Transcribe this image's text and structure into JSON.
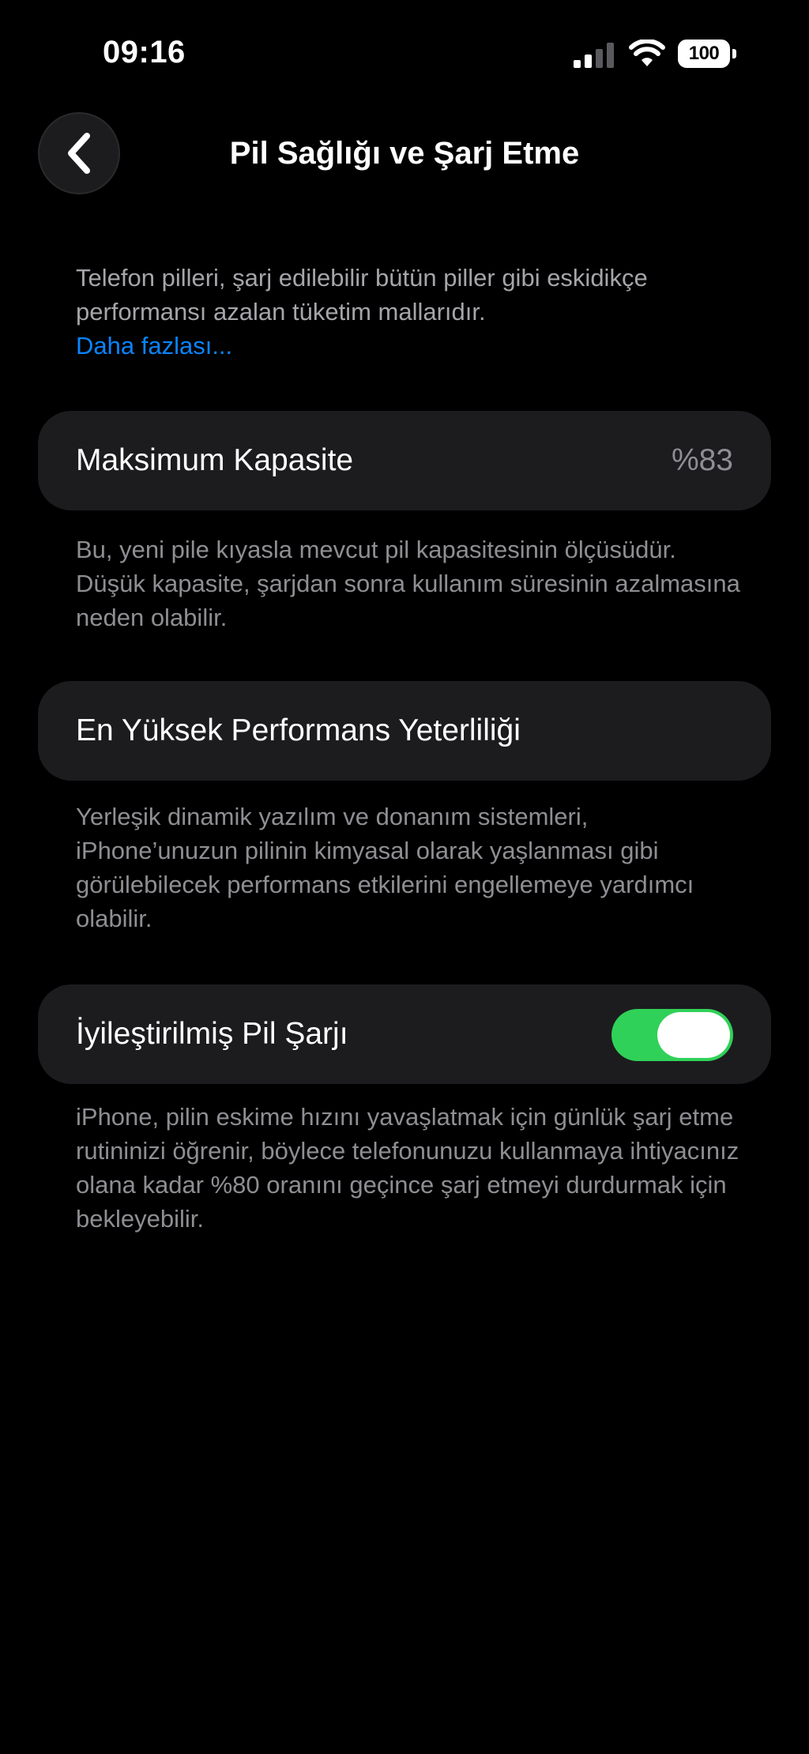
{
  "status_bar": {
    "time": "09:16",
    "battery_level": "100",
    "signal_icon": "cellular-signal-icon",
    "wifi_icon": "wifi-icon",
    "battery_icon": "battery-icon"
  },
  "nav": {
    "back_icon": "chevron-left-icon",
    "title": "Pil Sağlığı ve Şarj Etme"
  },
  "intro": {
    "text": "Telefon pilleri, şarj edilebilir bütün piller gibi eskidikçe performansı azalan tüketim mallarıdır.",
    "link": "Daha fazlası..."
  },
  "max_capacity": {
    "label": "Maksimum Kapasite",
    "value": "%83",
    "description": "Bu, yeni pile kıyasla mevcut pil kapasitesinin ölçüsüdür. Düşük kapasite, şarjdan sonra kullanım süresinin azalmasına neden olabilir."
  },
  "peak_performance": {
    "label": "En Yüksek Performans Yeterliliği",
    "description": "Yerleşik dinamik yazılım ve donanım sistemleri, iPhone’unuzun pilinin kimyasal olarak yaşlanması gibi görülebilecek performans etkilerini engellemeye yardımcı olabilir."
  },
  "optimized_charging": {
    "label": "İyileştirilmiş Pil Şarjı",
    "enabled": true,
    "description": "iPhone, pilin eskime hızını yavaşlatmak için günlük şarj etme rutininizi öğrenir, böylece telefonunuzu kullanmaya ihtiyacınız olana kadar %80 oranını geçince şarj etmeyi durdurmak için bekleyebilir."
  },
  "colors": {
    "background": "#000000",
    "card": "#1c1c1e",
    "secondary_text": "#8e8e93",
    "link": "#0a84ff",
    "toggle_on": "#30d158"
  }
}
